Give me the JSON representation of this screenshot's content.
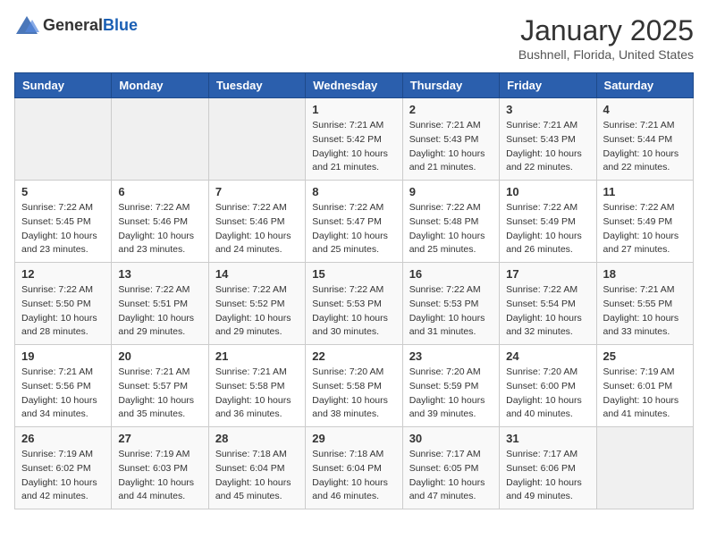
{
  "logo": {
    "general": "General",
    "blue": "Blue"
  },
  "calendar": {
    "title": "January 2025",
    "subtitle": "Bushnell, Florida, United States"
  },
  "days_of_week": [
    "Sunday",
    "Monday",
    "Tuesday",
    "Wednesday",
    "Thursday",
    "Friday",
    "Saturday"
  ],
  "weeks": [
    [
      {
        "day": "",
        "sunrise": "",
        "sunset": "",
        "daylight": "",
        "empty": true
      },
      {
        "day": "",
        "sunrise": "",
        "sunset": "",
        "daylight": "",
        "empty": true
      },
      {
        "day": "",
        "sunrise": "",
        "sunset": "",
        "daylight": "",
        "empty": true
      },
      {
        "day": "1",
        "sunrise": "Sunrise: 7:21 AM",
        "sunset": "Sunset: 5:42 PM",
        "daylight": "Daylight: 10 hours and 21 minutes."
      },
      {
        "day": "2",
        "sunrise": "Sunrise: 7:21 AM",
        "sunset": "Sunset: 5:43 PM",
        "daylight": "Daylight: 10 hours and 21 minutes."
      },
      {
        "day": "3",
        "sunrise": "Sunrise: 7:21 AM",
        "sunset": "Sunset: 5:43 PM",
        "daylight": "Daylight: 10 hours and 22 minutes."
      },
      {
        "day": "4",
        "sunrise": "Sunrise: 7:21 AM",
        "sunset": "Sunset: 5:44 PM",
        "daylight": "Daylight: 10 hours and 22 minutes."
      }
    ],
    [
      {
        "day": "5",
        "sunrise": "Sunrise: 7:22 AM",
        "sunset": "Sunset: 5:45 PM",
        "daylight": "Daylight: 10 hours and 23 minutes."
      },
      {
        "day": "6",
        "sunrise": "Sunrise: 7:22 AM",
        "sunset": "Sunset: 5:46 PM",
        "daylight": "Daylight: 10 hours and 23 minutes."
      },
      {
        "day": "7",
        "sunrise": "Sunrise: 7:22 AM",
        "sunset": "Sunset: 5:46 PM",
        "daylight": "Daylight: 10 hours and 24 minutes."
      },
      {
        "day": "8",
        "sunrise": "Sunrise: 7:22 AM",
        "sunset": "Sunset: 5:47 PM",
        "daylight": "Daylight: 10 hours and 25 minutes."
      },
      {
        "day": "9",
        "sunrise": "Sunrise: 7:22 AM",
        "sunset": "Sunset: 5:48 PM",
        "daylight": "Daylight: 10 hours and 25 minutes."
      },
      {
        "day": "10",
        "sunrise": "Sunrise: 7:22 AM",
        "sunset": "Sunset: 5:49 PM",
        "daylight": "Daylight: 10 hours and 26 minutes."
      },
      {
        "day": "11",
        "sunrise": "Sunrise: 7:22 AM",
        "sunset": "Sunset: 5:49 PM",
        "daylight": "Daylight: 10 hours and 27 minutes."
      }
    ],
    [
      {
        "day": "12",
        "sunrise": "Sunrise: 7:22 AM",
        "sunset": "Sunset: 5:50 PM",
        "daylight": "Daylight: 10 hours and 28 minutes."
      },
      {
        "day": "13",
        "sunrise": "Sunrise: 7:22 AM",
        "sunset": "Sunset: 5:51 PM",
        "daylight": "Daylight: 10 hours and 29 minutes."
      },
      {
        "day": "14",
        "sunrise": "Sunrise: 7:22 AM",
        "sunset": "Sunset: 5:52 PM",
        "daylight": "Daylight: 10 hours and 29 minutes."
      },
      {
        "day": "15",
        "sunrise": "Sunrise: 7:22 AM",
        "sunset": "Sunset: 5:53 PM",
        "daylight": "Daylight: 10 hours and 30 minutes."
      },
      {
        "day": "16",
        "sunrise": "Sunrise: 7:22 AM",
        "sunset": "Sunset: 5:53 PM",
        "daylight": "Daylight: 10 hours and 31 minutes."
      },
      {
        "day": "17",
        "sunrise": "Sunrise: 7:22 AM",
        "sunset": "Sunset: 5:54 PM",
        "daylight": "Daylight: 10 hours and 32 minutes."
      },
      {
        "day": "18",
        "sunrise": "Sunrise: 7:21 AM",
        "sunset": "Sunset: 5:55 PM",
        "daylight": "Daylight: 10 hours and 33 minutes."
      }
    ],
    [
      {
        "day": "19",
        "sunrise": "Sunrise: 7:21 AM",
        "sunset": "Sunset: 5:56 PM",
        "daylight": "Daylight: 10 hours and 34 minutes."
      },
      {
        "day": "20",
        "sunrise": "Sunrise: 7:21 AM",
        "sunset": "Sunset: 5:57 PM",
        "daylight": "Daylight: 10 hours and 35 minutes."
      },
      {
        "day": "21",
        "sunrise": "Sunrise: 7:21 AM",
        "sunset": "Sunset: 5:58 PM",
        "daylight": "Daylight: 10 hours and 36 minutes."
      },
      {
        "day": "22",
        "sunrise": "Sunrise: 7:20 AM",
        "sunset": "Sunset: 5:58 PM",
        "daylight": "Daylight: 10 hours and 38 minutes."
      },
      {
        "day": "23",
        "sunrise": "Sunrise: 7:20 AM",
        "sunset": "Sunset: 5:59 PM",
        "daylight": "Daylight: 10 hours and 39 minutes."
      },
      {
        "day": "24",
        "sunrise": "Sunrise: 7:20 AM",
        "sunset": "Sunset: 6:00 PM",
        "daylight": "Daylight: 10 hours and 40 minutes."
      },
      {
        "day": "25",
        "sunrise": "Sunrise: 7:19 AM",
        "sunset": "Sunset: 6:01 PM",
        "daylight": "Daylight: 10 hours and 41 minutes."
      }
    ],
    [
      {
        "day": "26",
        "sunrise": "Sunrise: 7:19 AM",
        "sunset": "Sunset: 6:02 PM",
        "daylight": "Daylight: 10 hours and 42 minutes."
      },
      {
        "day": "27",
        "sunrise": "Sunrise: 7:19 AM",
        "sunset": "Sunset: 6:03 PM",
        "daylight": "Daylight: 10 hours and 44 minutes."
      },
      {
        "day": "28",
        "sunrise": "Sunrise: 7:18 AM",
        "sunset": "Sunset: 6:04 PM",
        "daylight": "Daylight: 10 hours and 45 minutes."
      },
      {
        "day": "29",
        "sunrise": "Sunrise: 7:18 AM",
        "sunset": "Sunset: 6:04 PM",
        "daylight": "Daylight: 10 hours and 46 minutes."
      },
      {
        "day": "30",
        "sunrise": "Sunrise: 7:17 AM",
        "sunset": "Sunset: 6:05 PM",
        "daylight": "Daylight: 10 hours and 47 minutes."
      },
      {
        "day": "31",
        "sunrise": "Sunrise: 7:17 AM",
        "sunset": "Sunset: 6:06 PM",
        "daylight": "Daylight: 10 hours and 49 minutes."
      },
      {
        "day": "",
        "sunrise": "",
        "sunset": "",
        "daylight": "",
        "empty": true
      }
    ]
  ]
}
